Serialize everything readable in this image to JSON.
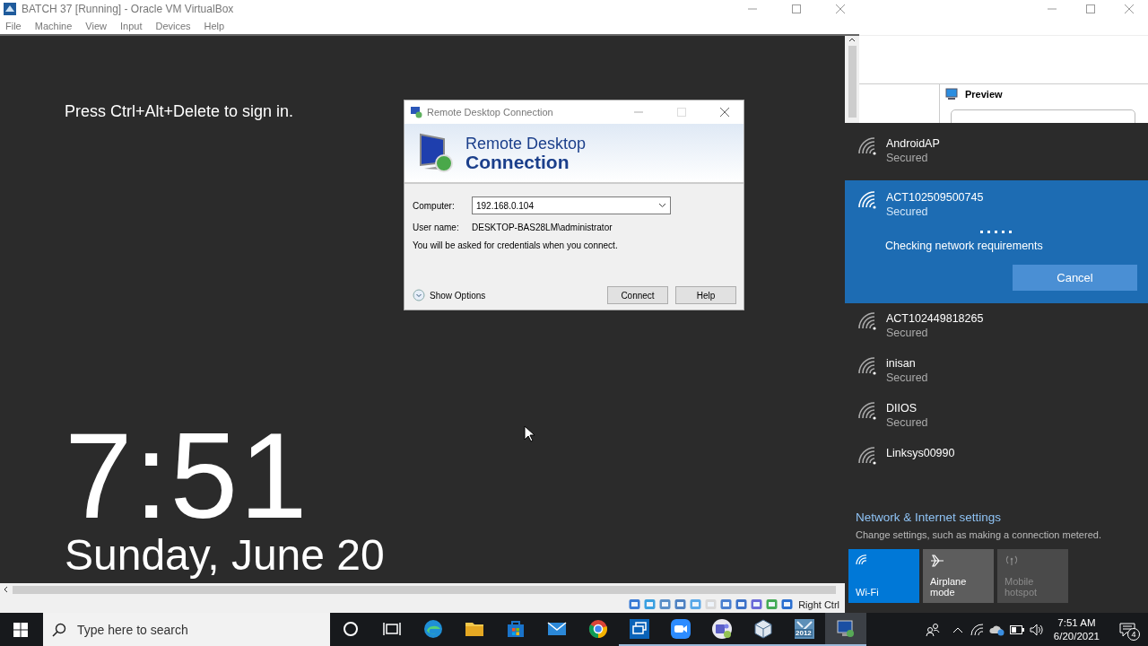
{
  "vbox": {
    "title": "BATCH 37 [Running] - Oracle VM VirtualBox",
    "menu": [
      "File",
      "Machine",
      "View",
      "Input",
      "Devices",
      "Help"
    ],
    "lock_screen": {
      "prompt": "Press Ctrl+Alt+Delete to sign in.",
      "time": "7:51",
      "date": "Sunday, June 20"
    },
    "status_bar": {
      "host_key": "Right Ctrl"
    }
  },
  "rdc_dialog": {
    "title": "Remote Desktop Connection",
    "heading_line1": "Remote Desktop",
    "heading_line2": "Connection",
    "computer_label": "Computer:",
    "computer": "192.168.0.104",
    "username_label": "User name:",
    "username": "DESKTOP-BAS28LM\\administrator",
    "note": "You will be asked for credentials when you connect.",
    "show_options": "Show Options",
    "buttons": [
      "Connect",
      "Help"
    ]
  },
  "background_window": {
    "section": "Preview"
  },
  "wifi_flyout": {
    "networks": [
      {
        "name": "AndroidAP",
        "status": "Secured",
        "selected": false
      },
      {
        "name": "ACT102509500745",
        "status": "Secured",
        "selected": true,
        "progress": "Checking network requirements",
        "action": "Cancel"
      },
      {
        "name": "ACT102449818265",
        "status": "Secured",
        "selected": false
      },
      {
        "name": "inisan",
        "status": "Secured",
        "selected": false
      },
      {
        "name": "DIIOS",
        "status": "Secured",
        "selected": false
      },
      {
        "name": "Linksys00990",
        "selected": false
      }
    ],
    "settings_link": "Network & Internet settings",
    "settings_hint": "Change settings, such as making a connection metered.",
    "tiles": [
      {
        "label": "Wi-Fi",
        "kind": "wifi",
        "on": true,
        "disabled": false
      },
      {
        "label": "Airplane mode",
        "kind": "airplane",
        "on": false,
        "disabled": false
      },
      {
        "label": "Mobile hotspot",
        "kind": "hotspot",
        "on": false,
        "disabled": true
      }
    ]
  },
  "taskbar": {
    "search_placeholder": "Type here to search",
    "apps": [
      {
        "kind": "cortana",
        "running": false,
        "active": false
      },
      {
        "kind": "taskview",
        "running": false,
        "active": false
      },
      {
        "kind": "browser",
        "running": false,
        "active": false
      },
      {
        "kind": "folder",
        "running": false,
        "active": false
      },
      {
        "kind": "store",
        "running": false,
        "active": false
      },
      {
        "kind": "mail",
        "running": false,
        "active": false
      },
      {
        "kind": "chrome",
        "running": false,
        "active": false
      },
      {
        "kind": "remote",
        "running": true,
        "active": false
      },
      {
        "kind": "video",
        "running": true,
        "active": false
      },
      {
        "kind": "teams",
        "running": true,
        "active": false
      },
      {
        "kind": "cube",
        "running": true,
        "active": false
      },
      {
        "kind": "sql",
        "badge": "2012",
        "running": true,
        "active": false
      },
      {
        "kind": "monitor",
        "running": true,
        "active": true
      }
    ],
    "clock_time": "7:51 AM",
    "clock_date": "6/20/2021",
    "notifications": "4"
  }
}
